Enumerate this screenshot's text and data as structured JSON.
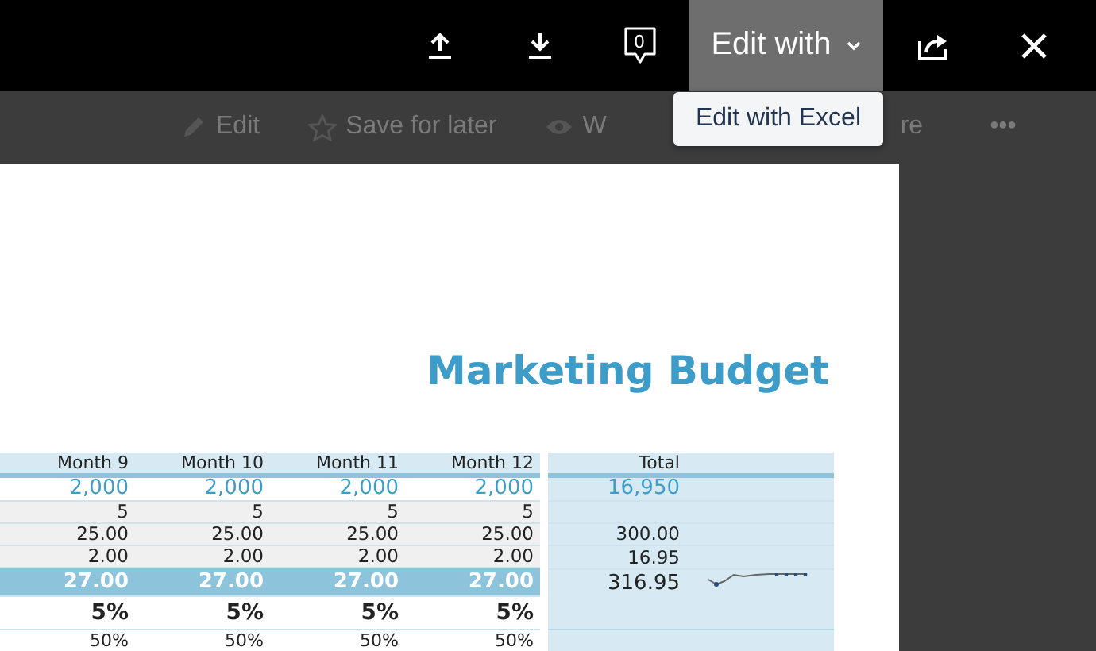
{
  "top_bar": {
    "actions": [
      {
        "kind": "upload"
      },
      {
        "kind": "download"
      },
      {
        "kind": "comments",
        "count": "0"
      },
      {
        "kind": "edit_with",
        "label": "Edit with",
        "expanded": true
      },
      {
        "kind": "share"
      },
      {
        "kind": "close"
      }
    ]
  },
  "dropdown_menu": {
    "items": [
      "Edit with Excel"
    ]
  },
  "toolbar": {
    "items": [
      {
        "kind": "edit",
        "label": "Edit"
      },
      {
        "kind": "star",
        "label": "Save for later"
      },
      {
        "kind": "eye",
        "label": "W"
      },
      {
        "kind": "text",
        "label": "re"
      },
      {
        "kind": "text",
        "label": "•••"
      }
    ]
  },
  "document": {
    "title": "Marketing Budget",
    "columns": [
      "Month 9",
      "Month 10",
      "Month 11",
      "Month 12"
    ],
    "total_heading": "Total",
    "rows": [
      {
        "kind": "input",
        "cells": [
          "2,000",
          "2,000",
          "2,000",
          "2,000"
        ],
        "total": "16,950"
      },
      {
        "kind": "plain",
        "cells": [
          "5",
          "5",
          "5",
          "5"
        ]
      },
      {
        "kind": "plain",
        "cells": [
          "25.00",
          "25.00",
          "25.00",
          "25.00"
        ],
        "total": "300.00"
      },
      {
        "kind": "plain",
        "cells": [
          "2.00",
          "2.00",
          "2.00",
          "2.00"
        ],
        "total": "16.95"
      },
      {
        "kind": "total",
        "cells": [
          "27.00",
          "27.00",
          "27.00",
          "27.00"
        ],
        "total": "316.95",
        "sparkline": true
      },
      {
        "kind": "percent",
        "cells": [
          "5%",
          "5%",
          "5%",
          "5%"
        ]
      },
      {
        "kind": "small",
        "cells": [
          "50%",
          "50%",
          "50%",
          "50%"
        ]
      }
    ]
  }
}
